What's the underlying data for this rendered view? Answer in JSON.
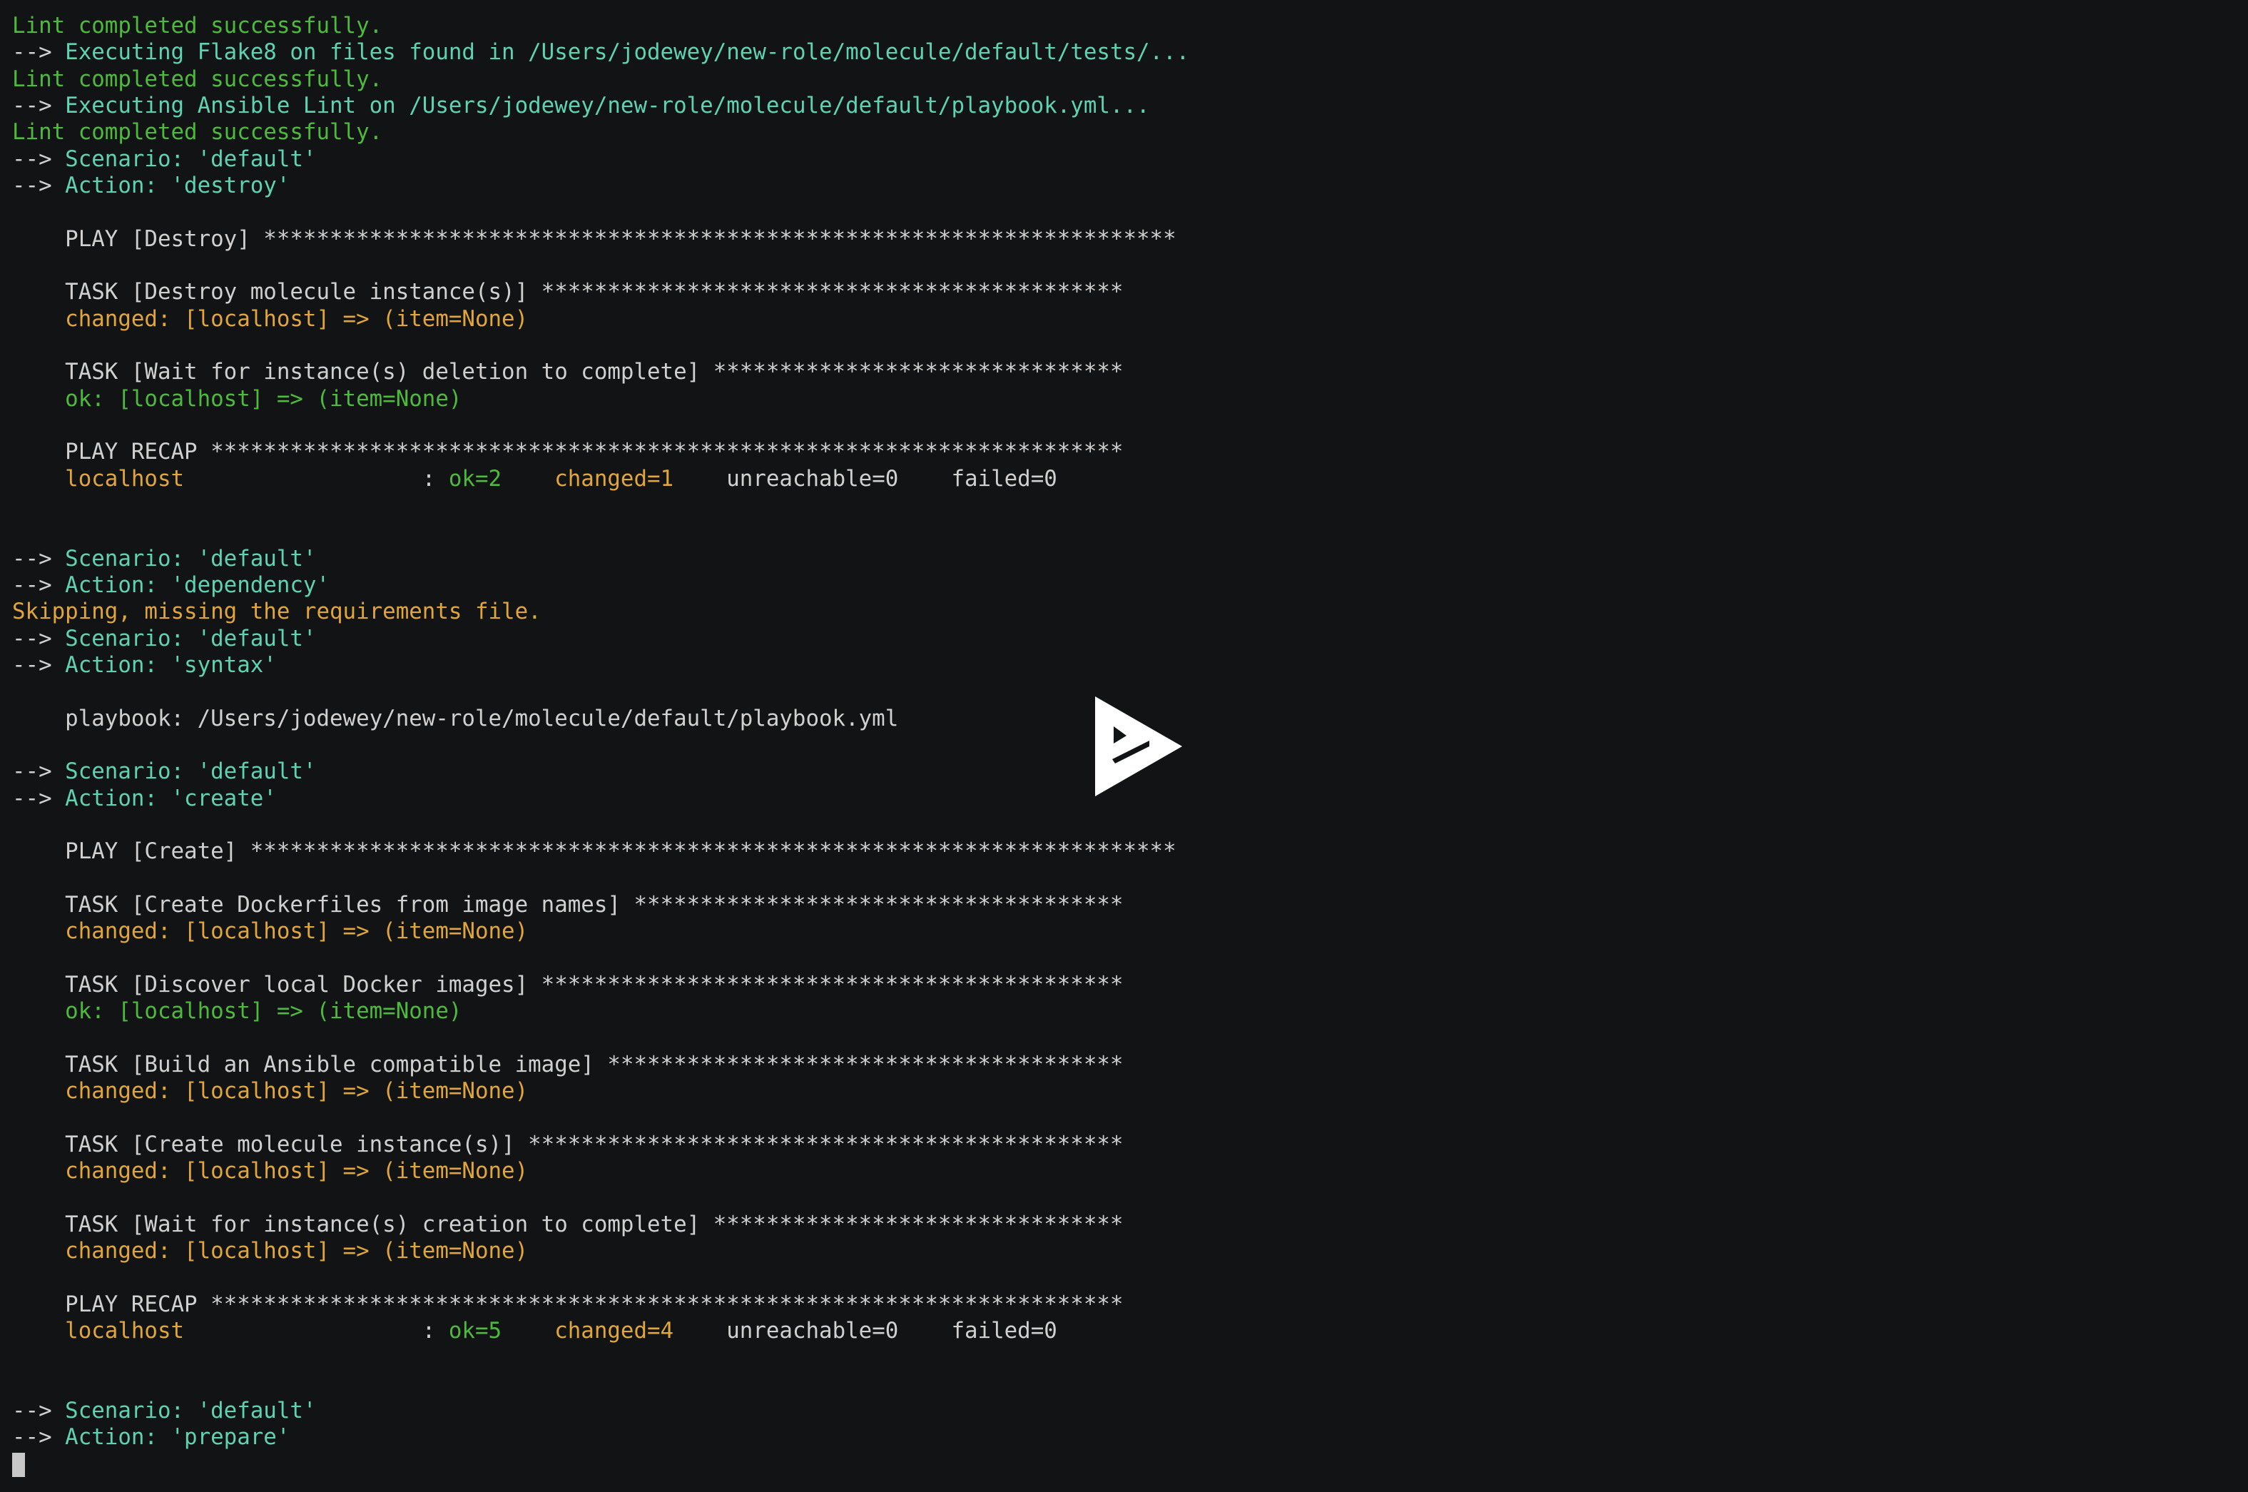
{
  "colors": {
    "background": "#121314",
    "default": "#d0d0d0",
    "green": "#4eba3d",
    "yellow": "#e0a63c",
    "cyan": "#5fd3b0"
  },
  "player": {
    "play_icon": "asciinema-play-icon"
  },
  "terminal": {
    "lines": [
      [
        {
          "t": "Lint completed successfully.",
          "c": "green"
        }
      ],
      [
        {
          "t": "--> ",
          "c": "default"
        },
        {
          "t": "Executing Flake8 on files found in /Users/jodewey/new-role/molecule/default/tests/...",
          "c": "cyan"
        }
      ],
      [
        {
          "t": "Lint completed successfully.",
          "c": "green"
        }
      ],
      [
        {
          "t": "--> ",
          "c": "default"
        },
        {
          "t": "Executing Ansible Lint on /Users/jodewey/new-role/molecule/default/playbook.yml...",
          "c": "cyan"
        }
      ],
      [
        {
          "t": "Lint completed successfully.",
          "c": "green"
        }
      ],
      [
        {
          "t": "--> ",
          "c": "default"
        },
        {
          "t": "Scenario: 'default'",
          "c": "cyan"
        }
      ],
      [
        {
          "t": "--> ",
          "c": "default"
        },
        {
          "t": "Action: 'destroy'",
          "c": "cyan"
        }
      ],
      [],
      [
        {
          "t": "    PLAY [Destroy] *********************************************************************",
          "c": "default"
        }
      ],
      [],
      [
        {
          "t": "    TASK [Destroy molecule instance(s)] ********************************************",
          "c": "default"
        }
      ],
      [
        {
          "t": "    changed: [localhost] => (item=None)",
          "c": "yellow"
        }
      ],
      [],
      [
        {
          "t": "    TASK [Wait for instance(s) deletion to complete] *******************************",
          "c": "default"
        }
      ],
      [
        {
          "t": "    ok: [localhost] => (item=None)",
          "c": "green"
        }
      ],
      [],
      [
        {
          "t": "    PLAY RECAP *********************************************************************",
          "c": "default"
        }
      ],
      [
        {
          "t": "    localhost",
          "c": "yellow"
        },
        {
          "t": "                  : ",
          "c": "default"
        },
        {
          "t": "ok=2",
          "c": "green"
        },
        {
          "t": "    ",
          "c": "default"
        },
        {
          "t": "changed=1",
          "c": "yellow"
        },
        {
          "t": "    unreachable=0    failed=0",
          "c": "default"
        }
      ],
      [],
      [],
      [
        {
          "t": "--> ",
          "c": "default"
        },
        {
          "t": "Scenario: 'default'",
          "c": "cyan"
        }
      ],
      [
        {
          "t": "--> ",
          "c": "default"
        },
        {
          "t": "Action: 'dependency'",
          "c": "cyan"
        }
      ],
      [
        {
          "t": "Skipping, missing the requirements file.",
          "c": "yellow"
        }
      ],
      [
        {
          "t": "--> ",
          "c": "default"
        },
        {
          "t": "Scenario: 'default'",
          "c": "cyan"
        }
      ],
      [
        {
          "t": "--> ",
          "c": "default"
        },
        {
          "t": "Action: 'syntax'",
          "c": "cyan"
        }
      ],
      [],
      [
        {
          "t": "    playbook: /Users/jodewey/new-role/molecule/default/playbook.yml",
          "c": "default"
        }
      ],
      [],
      [
        {
          "t": "--> ",
          "c": "default"
        },
        {
          "t": "Scenario: 'default'",
          "c": "cyan"
        }
      ],
      [
        {
          "t": "--> ",
          "c": "default"
        },
        {
          "t": "Action: 'create'",
          "c": "cyan"
        }
      ],
      [],
      [
        {
          "t": "    PLAY [Create] **********************************************************************",
          "c": "default"
        }
      ],
      [],
      [
        {
          "t": "    TASK [Create Dockerfiles from image names] *************************************",
          "c": "default"
        }
      ],
      [
        {
          "t": "    changed: [localhost] => (item=None)",
          "c": "yellow"
        }
      ],
      [],
      [
        {
          "t": "    TASK [Discover local Docker images] ********************************************",
          "c": "default"
        }
      ],
      [
        {
          "t": "    ok: [localhost] => (item=None)",
          "c": "green"
        }
      ],
      [],
      [
        {
          "t": "    TASK [Build an Ansible compatible image] ***************************************",
          "c": "default"
        }
      ],
      [
        {
          "t": "    changed: [localhost] => (item=None)",
          "c": "yellow"
        }
      ],
      [],
      [
        {
          "t": "    TASK [Create molecule instance(s)] *********************************************",
          "c": "default"
        }
      ],
      [
        {
          "t": "    changed: [localhost] => (item=None)",
          "c": "yellow"
        }
      ],
      [],
      [
        {
          "t": "    TASK [Wait for instance(s) creation to complete] *******************************",
          "c": "default"
        }
      ],
      [
        {
          "t": "    changed: [localhost] => (item=None)",
          "c": "yellow"
        }
      ],
      [],
      [
        {
          "t": "    PLAY RECAP *********************************************************************",
          "c": "default"
        }
      ],
      [
        {
          "t": "    localhost",
          "c": "yellow"
        },
        {
          "t": "                  : ",
          "c": "default"
        },
        {
          "t": "ok=5",
          "c": "green"
        },
        {
          "t": "    ",
          "c": "default"
        },
        {
          "t": "changed=4",
          "c": "yellow"
        },
        {
          "t": "    unreachable=0    failed=0",
          "c": "default"
        }
      ],
      [],
      [],
      [
        {
          "t": "--> ",
          "c": "default"
        },
        {
          "t": "Scenario: 'default'",
          "c": "cyan"
        }
      ],
      [
        {
          "t": "--> ",
          "c": "default"
        },
        {
          "t": "Action: 'prepare'",
          "c": "cyan"
        }
      ]
    ]
  }
}
